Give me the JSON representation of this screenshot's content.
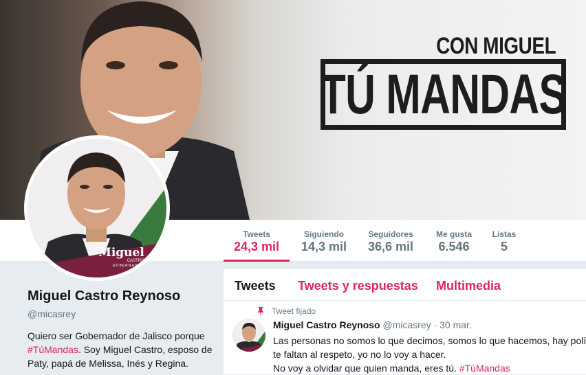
{
  "banner": {
    "slogan_small": "CON MIGUEL",
    "slogan_big": "TÚ MANDAS"
  },
  "avatar": {
    "logo_name": "Miguel",
    "logo_sub": "CASTRO",
    "logo_role": "GOBERNADOR"
  },
  "nav": {
    "stats": [
      {
        "label": "Tweets",
        "value": "24,3 mil",
        "active": true
      },
      {
        "label": "Siguiendo",
        "value": "14,3 mil"
      },
      {
        "label": "Seguidores",
        "value": "36,6 mil"
      },
      {
        "label": "Me gusta",
        "value": "6.546"
      },
      {
        "label": "Listas",
        "value": "5"
      }
    ]
  },
  "profile": {
    "name": "Miguel Castro Reynoso",
    "handle": "@micasrey",
    "bio_part1": "Quiero ser Gobernador de Jalisco porque",
    "bio_hashtag": "#TúMandas",
    "bio_part2": ". Soy Miguel Castro, esposo de Paty, papá de Melissa, Inés y Regina."
  },
  "timeline": {
    "tabs": [
      "Tweets",
      "Tweets y respuestas",
      "Multimedia"
    ],
    "pinned_label": "Tweet fijado",
    "tweet": {
      "name": "Miguel Castro Reynoso",
      "handle": "@micasrey",
      "date": "· 30 mar.",
      "line1": "Las personas no somos lo que decimos, somos lo que hacemos, hay polític",
      "line2": "te faltan al respeto, yo no lo voy a hacer.",
      "line3_text": "No voy a olvidar que quien manda, eres tú.",
      "line3_hashtag": "#TúMandas"
    }
  },
  "colors": {
    "accent": "#e0245e",
    "logo_green": "#3a7a3f",
    "logo_maroon": "#7a1f3d"
  }
}
